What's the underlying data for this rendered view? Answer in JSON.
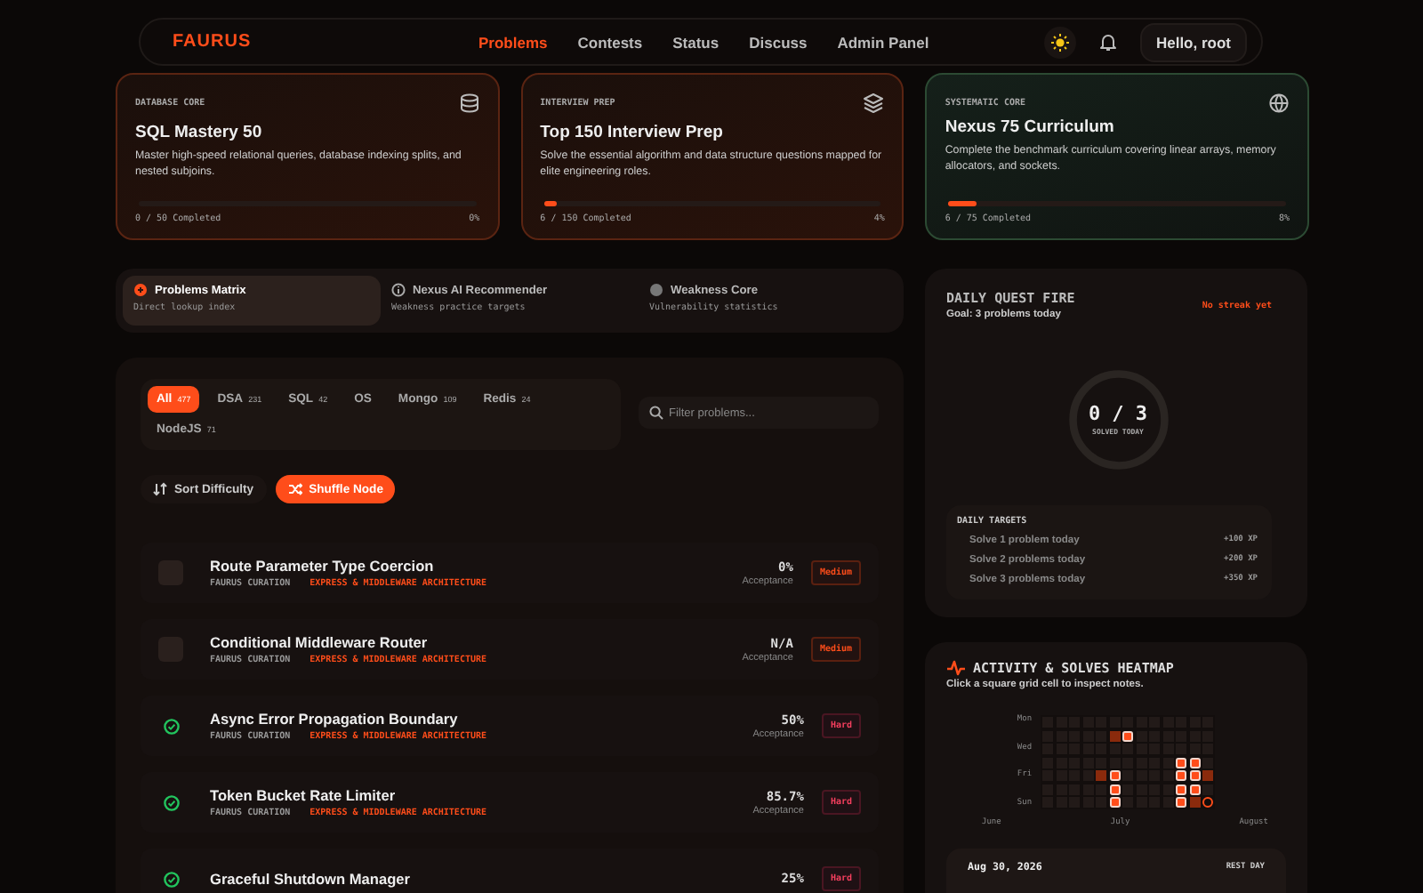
{
  "nav": {
    "logo": "FAURUS",
    "links": [
      {
        "label": "Problems",
        "selected": true
      },
      {
        "label": "Contests",
        "selected": false
      },
      {
        "label": "Status",
        "selected": false
      },
      {
        "label": "Discuss",
        "selected": false
      },
      {
        "label": "Admin Panel",
        "selected": false
      }
    ],
    "greeting": "Hello, root"
  },
  "tracks": [
    {
      "tag": "DATABASE CORE",
      "title": "SQL Mastery 50",
      "desc": "Master high-speed relational queries, database indexing splits, and nested subjoins.",
      "level": 0,
      "progress": "0 / 50 Completed",
      "percent": "0%",
      "selected": false
    },
    {
      "tag": "INTERVIEW PREP",
      "title": "Top 150 Interview Prep",
      "desc": "Solve the essential algorithm and data structure questions mapped for elite engineering roles.",
      "level": 0.04,
      "progress": "6 / 150 Completed",
      "percent": "4%",
      "selected": false
    },
    {
      "tag": "SYSTEMATIC CORE",
      "title": "Nexus 75 Curriculum",
      "desc": "Complete the benchmark curriculum covering linear arrays, memory allocators, and sockets.",
      "level": 0.08,
      "progress": "6 / 75 Completed",
      "percent": "8%",
      "selected": true
    }
  ],
  "modes": [
    {
      "title": "Problems Matrix",
      "sub": "Direct lookup index",
      "selected": true
    },
    {
      "title": "Nexus AI Recommender",
      "sub": "Weakness practice targets",
      "selected": false
    },
    {
      "title": "Weakness Core",
      "sub": "Vulnerability statistics",
      "selected": false
    }
  ],
  "filters": [
    {
      "label": "All",
      "count": "477",
      "selected": true
    },
    {
      "label": "DSA",
      "count": "231",
      "selected": false
    },
    {
      "label": "SQL",
      "count": "42",
      "selected": false
    },
    {
      "label": "OS",
      "selected": false
    },
    {
      "label": "Mongo",
      "count": "109",
      "selected": false
    },
    {
      "label": "Redis",
      "count": "24",
      "selected": false
    },
    {
      "label": "NodeJS",
      "count": "71",
      "selected": false
    }
  ],
  "search": {
    "placeholder": "Filter problems..."
  },
  "sort_button": "Sort Difficulty",
  "shuffle_button": "Shuffle Node",
  "problems": [
    {
      "solved": false,
      "title": "Route Parameter Type Coercion",
      "source": "FAURUS CURATION",
      "category": "EXPRESS & MIDDLEWARE ARCHITECTURE",
      "acceptance": "0%",
      "acceptance_label": "Acceptance",
      "difficulty": "Medium"
    },
    {
      "solved": false,
      "title": "Conditional Middleware Router",
      "source": "FAURUS CURATION",
      "category": "EXPRESS & MIDDLEWARE ARCHITECTURE",
      "acceptance": "N/A",
      "acceptance_label": "Acceptance",
      "difficulty": "Medium"
    },
    {
      "solved": true,
      "title": "Async Error Propagation Boundary",
      "source": "FAURUS CURATION",
      "category": "EXPRESS & MIDDLEWARE ARCHITECTURE",
      "acceptance": "50%",
      "acceptance_label": "Acceptance",
      "difficulty": "Hard"
    },
    {
      "solved": true,
      "title": "Token Bucket Rate Limiter",
      "source": "FAURUS CURATION",
      "category": "EXPRESS & MIDDLEWARE ARCHITECTURE",
      "acceptance": "85.7%",
      "acceptance_label": "Acceptance",
      "difficulty": "Hard"
    },
    {
      "solved": true,
      "title": "Graceful Shutdown Manager",
      "acceptance": "25%",
      "difficulty": "Hard"
    }
  ],
  "quest": {
    "title": "DAILY QUEST FIRE",
    "goal": "Goal: 3 problems today",
    "streak": "No streak yet",
    "level": 0,
    "count": "0 / 3",
    "count_label": "SOLVED TODAY",
    "targets_title": "DAILY TARGETS",
    "targets": [
      {
        "label": "Solve 1 problem today",
        "xp": "+100 XP"
      },
      {
        "label": "Solve 2 problems today",
        "xp": "+200 XP"
      },
      {
        "label": "Solve 3 problems today",
        "xp": "+350 XP"
      }
    ]
  },
  "heatmap": {
    "title": "ACTIVITY & SOLVES HEATMAP",
    "hint": "Click a square grid cell to inspect notes.",
    "day_labels": [
      "Mon",
      "Wed",
      "Fri",
      "Sun"
    ],
    "months": [
      "June",
      "July",
      "August"
    ],
    "weeks": [
      {
        "days": [
          {
            "kind": "empty"
          },
          {
            "kind": "empty"
          },
          {
            "kind": "empty"
          },
          {
            "kind": "empty"
          },
          {
            "kind": "empty"
          },
          {
            "kind": "empty"
          },
          {
            "kind": "empty"
          }
        ]
      },
      {
        "days": [
          {
            "kind": "empty"
          },
          {
            "kind": "empty"
          },
          {
            "kind": "empty"
          },
          {
            "kind": "empty"
          },
          {
            "kind": "empty"
          },
          {
            "kind": "empty"
          },
          {
            "kind": "empty"
          }
        ]
      },
      {
        "days": [
          {
            "kind": "empty"
          },
          {
            "kind": "empty"
          },
          {
            "kind": "empty"
          },
          {
            "kind": "empty"
          },
          {
            "kind": "empty"
          },
          {
            "kind": "empty"
          },
          {
            "kind": "empty"
          }
        ]
      },
      {
        "days": [
          {
            "kind": "empty"
          },
          {
            "kind": "empty"
          },
          {
            "kind": "empty"
          },
          {
            "kind": "empty"
          },
          {
            "kind": "empty"
          },
          {
            "kind": "empty"
          },
          {
            "kind": "empty"
          }
        ]
      },
      {
        "days": [
          {
            "kind": "empty"
          },
          {
            "kind": "empty"
          },
          {
            "kind": "empty"
          },
          {
            "kind": "empty"
          },
          {
            "kind": "low"
          },
          {
            "kind": "empty"
          },
          {
            "kind": "empty"
          }
        ]
      },
      {
        "days": [
          {
            "kind": "empty"
          },
          {
            "kind": "low"
          },
          {
            "kind": "empty"
          },
          {
            "kind": "empty"
          },
          {
            "kind": "high"
          },
          {
            "kind": "high"
          },
          {
            "kind": "high"
          }
        ]
      },
      {
        "days": [
          {
            "kind": "empty"
          },
          {
            "kind": "high"
          },
          {
            "kind": "empty"
          },
          {
            "kind": "empty"
          },
          {
            "kind": "empty"
          },
          {
            "kind": "empty"
          },
          {
            "kind": "empty"
          }
        ]
      },
      {
        "days": [
          {
            "kind": "empty"
          },
          {
            "kind": "empty"
          },
          {
            "kind": "empty"
          },
          {
            "kind": "empty"
          },
          {
            "kind": "empty"
          },
          {
            "kind": "empty"
          },
          {
            "kind": "empty"
          }
        ]
      },
      {
        "days": [
          {
            "kind": "empty"
          },
          {
            "kind": "empty"
          },
          {
            "kind": "empty"
          },
          {
            "kind": "empty"
          },
          {
            "kind": "empty"
          },
          {
            "kind": "empty"
          },
          {
            "kind": "empty"
          }
        ]
      },
      {
        "days": [
          {
            "kind": "empty"
          },
          {
            "kind": "empty"
          },
          {
            "kind": "empty"
          },
          {
            "kind": "empty"
          },
          {
            "kind": "empty"
          },
          {
            "kind": "empty"
          },
          {
            "kind": "empty"
          }
        ]
      },
      {
        "days": [
          {
            "kind": "empty"
          },
          {
            "kind": "empty"
          },
          {
            "kind": "empty"
          },
          {
            "kind": "high"
          },
          {
            "kind": "high"
          },
          {
            "kind": "high"
          },
          {
            "kind": "high"
          }
        ]
      },
      {
        "days": [
          {
            "kind": "empty"
          },
          {
            "kind": "empty"
          },
          {
            "kind": "empty"
          },
          {
            "kind": "high"
          },
          {
            "kind": "high"
          },
          {
            "kind": "high"
          },
          {
            "kind": "low"
          }
        ]
      },
      {
        "days": [
          {
            "kind": "empty"
          },
          {
            "kind": "empty"
          },
          {
            "kind": "empty"
          },
          {
            "kind": "empty"
          },
          {
            "kind": "low"
          },
          {
            "kind": "empty"
          },
          {
            "kind": "today"
          }
        ]
      }
    ],
    "detail_date": "Aug 30, 2026",
    "detail_tag": "REST DAY"
  }
}
